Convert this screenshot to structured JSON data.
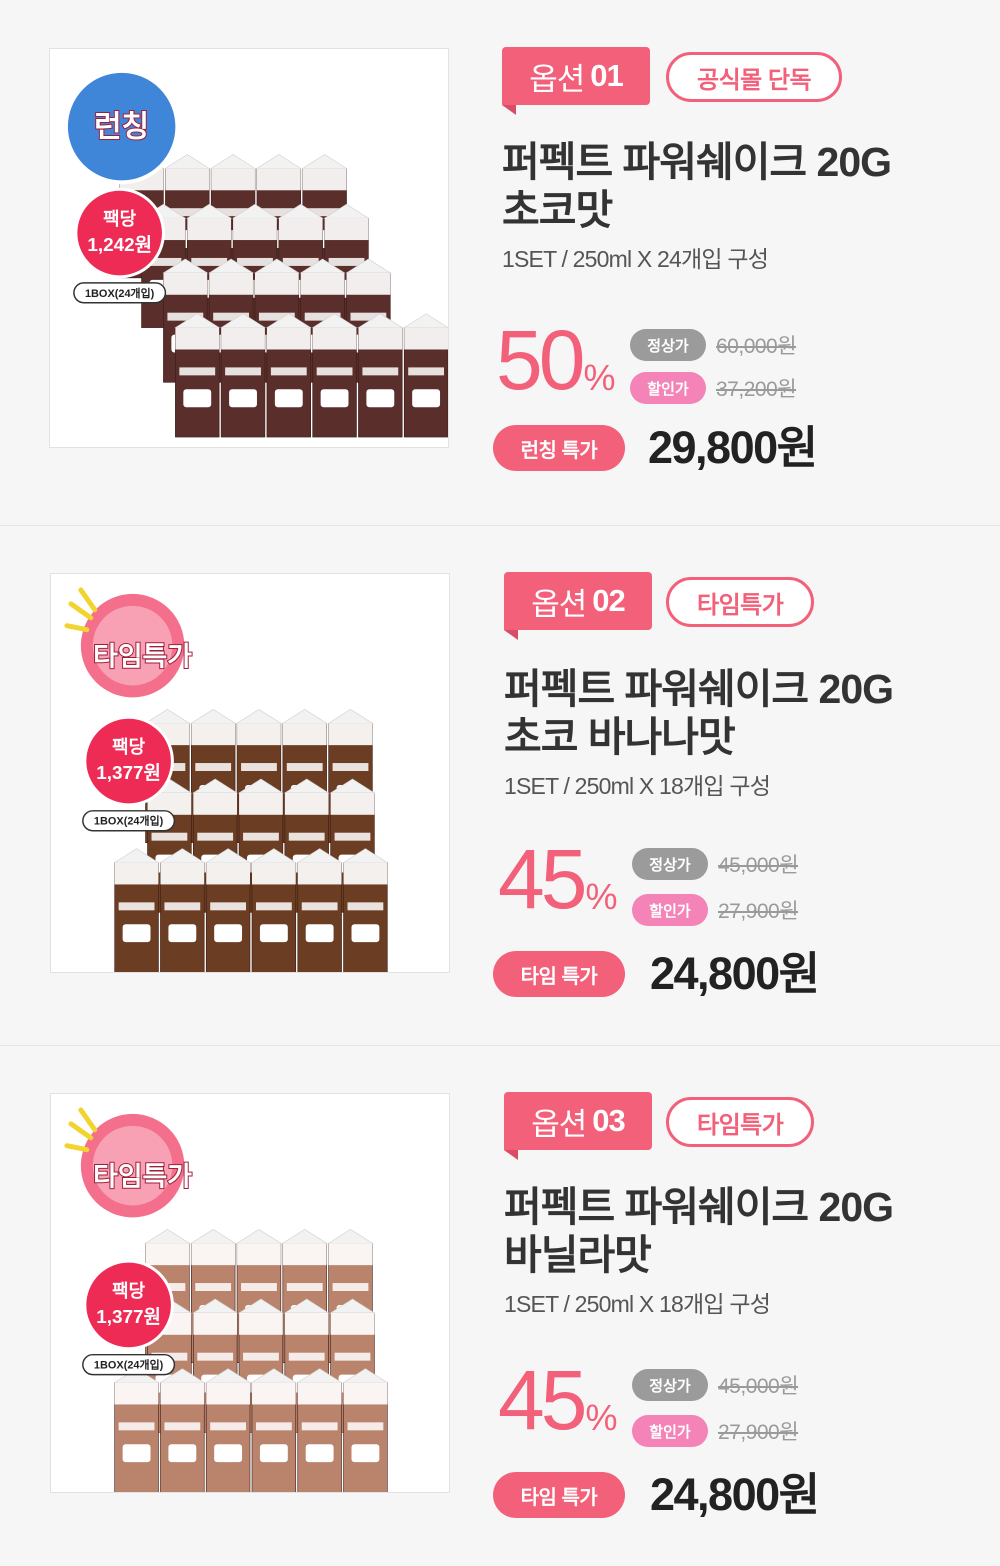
{
  "options": [
    {
      "option_label": "옵션",
      "option_number": "01",
      "badge": "공식몰 단독",
      "title_line1": "퍼펙트 파워쉐이크 20G",
      "title_line2": "초코맛",
      "spec": "1SET / 250ml X  24개입 구성",
      "discount_number": "50",
      "discount_symbol": "%",
      "regular_label": "정상가",
      "regular_price": "60,000원",
      "sale_label": "할인가",
      "sale_price": "37,200원",
      "deal_label": "런칭 특가",
      "final_price": "29,800원",
      "sticker_text": "런칭",
      "pack_label": "팩당",
      "pack_price": "1,242원",
      "box_label": "1BOX(24개입)",
      "carton_color": "#5a2e2a"
    },
    {
      "option_label": "옵션",
      "option_number": "02",
      "badge": "타임특가",
      "title_line1": "퍼펙트 파워쉐이크 20G",
      "title_line2": "초코 바나나맛",
      "spec": "1SET / 250ml X  18개입 구성",
      "discount_number": "45",
      "discount_symbol": "%",
      "regular_label": "정상가",
      "regular_price": "45,000원",
      "sale_label": "할인가",
      "sale_price": "27,900원",
      "deal_label": "타임 특가",
      "final_price": "24,800원",
      "sticker_text": "타임특가",
      "pack_label": "팩당",
      "pack_price": "1,377원",
      "box_label": "1BOX(24개입)",
      "carton_color": "#6b3d22"
    },
    {
      "option_label": "옵션",
      "option_number": "03",
      "badge": "타임특가",
      "title_line1": "퍼펙트 파워쉐이크 20G",
      "title_line2": "바닐라맛",
      "spec": "1SET / 250ml X  18개입 구성",
      "discount_number": "45",
      "discount_symbol": "%",
      "regular_label": "정상가",
      "regular_price": "45,000원",
      "sale_label": "할인가",
      "sale_price": "27,900원",
      "deal_label": "타임 특가",
      "final_price": "24,800원",
      "sticker_text": "타임특가",
      "pack_label": "팩당",
      "pack_price": "1,377원",
      "box_label": "1BOX(24개입)",
      "carton_color": "#b9836c"
    }
  ],
  "colors": {
    "accent": "#f2607a",
    "pink_pill": "#f483b7",
    "gray_pill": "#9b9b9b"
  }
}
